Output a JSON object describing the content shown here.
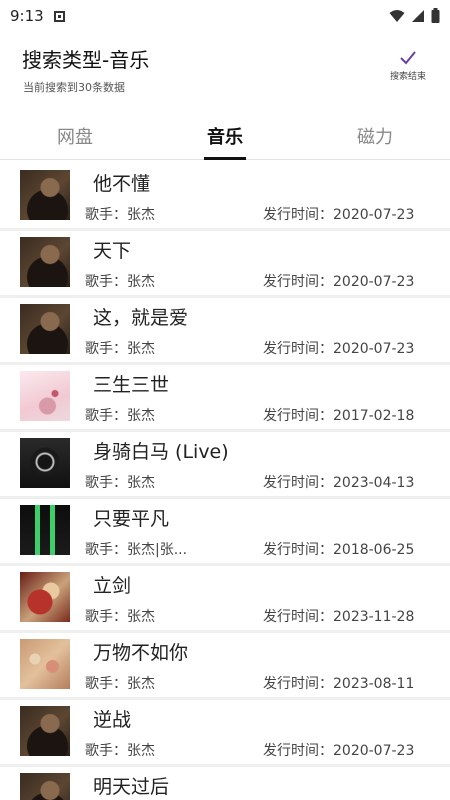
{
  "status_bar": {
    "time": "9:13"
  },
  "header": {
    "title": "搜索类型-音乐",
    "subtitle": "当前搜索到30条数据",
    "finish_label": "搜索结束"
  },
  "tabs": [
    {
      "label": "网盘",
      "active": false
    },
    {
      "label": "音乐",
      "active": true
    },
    {
      "label": "磁力",
      "active": false
    }
  ],
  "songs": [
    {
      "title": "他不懂",
      "singer": "歌手：张杰",
      "date": "发行时间：2020-07-23",
      "cover": "portrait"
    },
    {
      "title": "天下",
      "singer": "歌手：张杰",
      "date": "发行时间：2020-07-23",
      "cover": "portrait"
    },
    {
      "title": "这，就是爱",
      "singer": "歌手：张杰",
      "date": "发行时间：2020-07-23",
      "cover": "portrait"
    },
    {
      "title": "三生三世",
      "singer": "歌手：张杰",
      "date": "发行时间：2017-02-18",
      "cover": "pink"
    },
    {
      "title": "身骑白马 (Live)",
      "singer": "歌手：张杰",
      "date": "发行时间：2023-04-13",
      "cover": "dark"
    },
    {
      "title": "只要平凡",
      "singer": "歌手：张杰|张...",
      "date": "发行时间：2018-06-25",
      "cover": "green"
    },
    {
      "title": "立剑",
      "singer": "歌手：张杰",
      "date": "发行时间：2023-11-28",
      "cover": "red"
    },
    {
      "title": "万物不如你",
      "singer": "歌手：张杰",
      "date": "发行时间：2023-08-11",
      "cover": "tan"
    },
    {
      "title": "逆战",
      "singer": "歌手：张杰",
      "date": "发行时间：2020-07-23",
      "cover": "portrait"
    },
    {
      "title": "明天过后",
      "singer": "",
      "date": "",
      "cover": "portrait"
    }
  ],
  "colors": {
    "finish_check": "#6a3fa0",
    "active_tab": "#111111",
    "inactive_tab": "#888888"
  },
  "icons": {
    "wifi": "wifi-icon",
    "signal": "signal-icon",
    "battery": "battery-icon",
    "finish": "check-icon"
  }
}
